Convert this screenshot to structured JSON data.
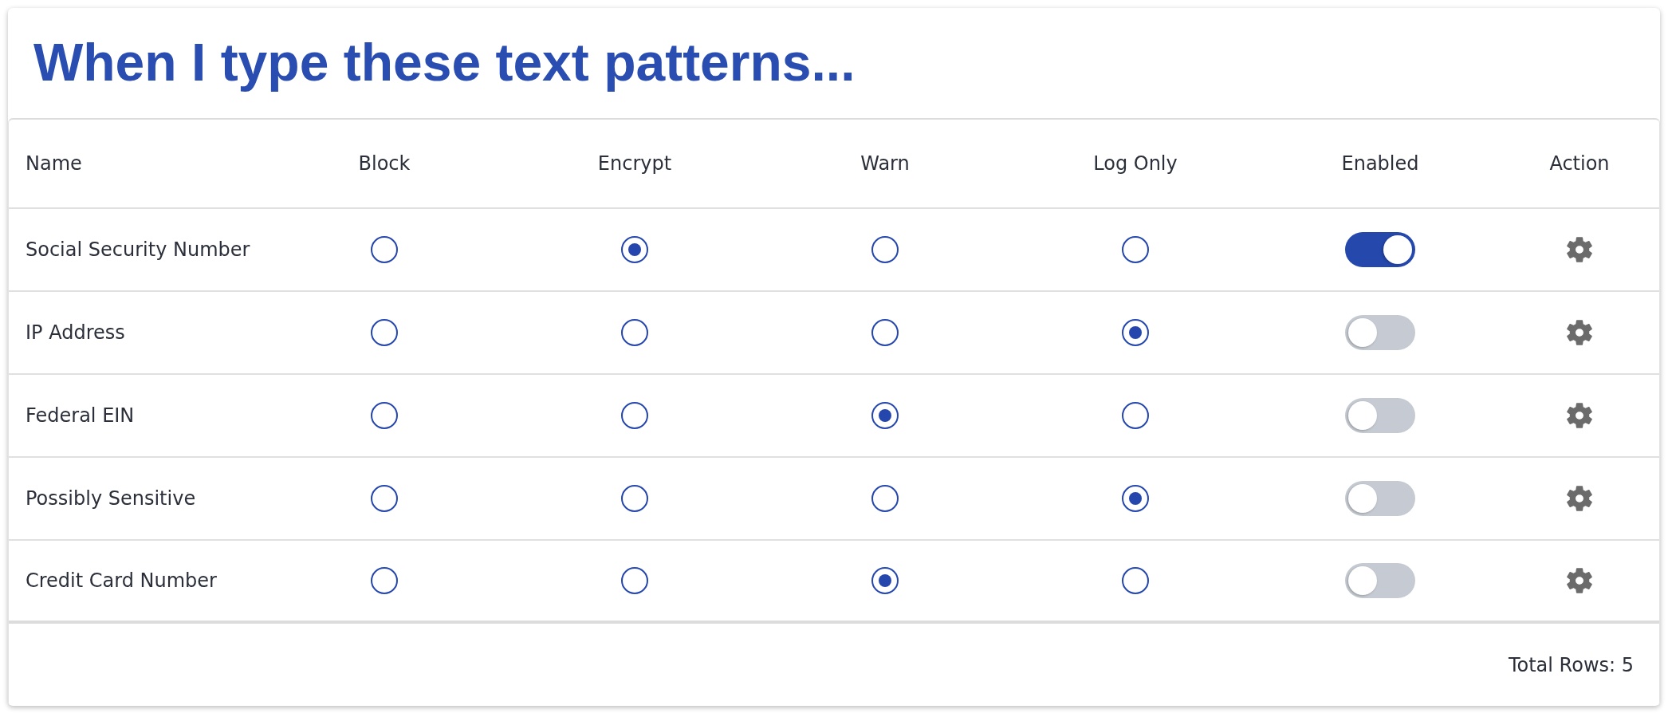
{
  "title": "When I type these text patterns...",
  "table": {
    "columns": [
      "Name",
      "Block",
      "Encrypt",
      "Warn",
      "Log Only",
      "Enabled",
      "Action"
    ],
    "rows": [
      {
        "name": "Social Security Number",
        "choices": [
          {
            "selected": false
          },
          {
            "selected": true
          },
          {
            "selected": false
          },
          {
            "selected": false
          }
        ],
        "enabled": true
      },
      {
        "name": "IP Address",
        "choices": [
          {
            "selected": false
          },
          {
            "selected": false
          },
          {
            "selected": false
          },
          {
            "selected": true
          }
        ],
        "enabled": false
      },
      {
        "name": "Federal EIN",
        "choices": [
          {
            "selected": false
          },
          {
            "selected": false
          },
          {
            "selected": true
          },
          {
            "selected": false
          }
        ],
        "enabled": false
      },
      {
        "name": "Possibly Sensitive",
        "choices": [
          {
            "selected": false
          },
          {
            "selected": false
          },
          {
            "selected": false
          },
          {
            "selected": true
          }
        ],
        "enabled": false
      },
      {
        "name": "Credit Card Number",
        "choices": [
          {
            "selected": false
          },
          {
            "selected": false
          },
          {
            "selected": true
          },
          {
            "selected": false
          }
        ],
        "enabled": false
      }
    ]
  },
  "footer": {
    "total_rows": "Total Rows: 5"
  }
}
